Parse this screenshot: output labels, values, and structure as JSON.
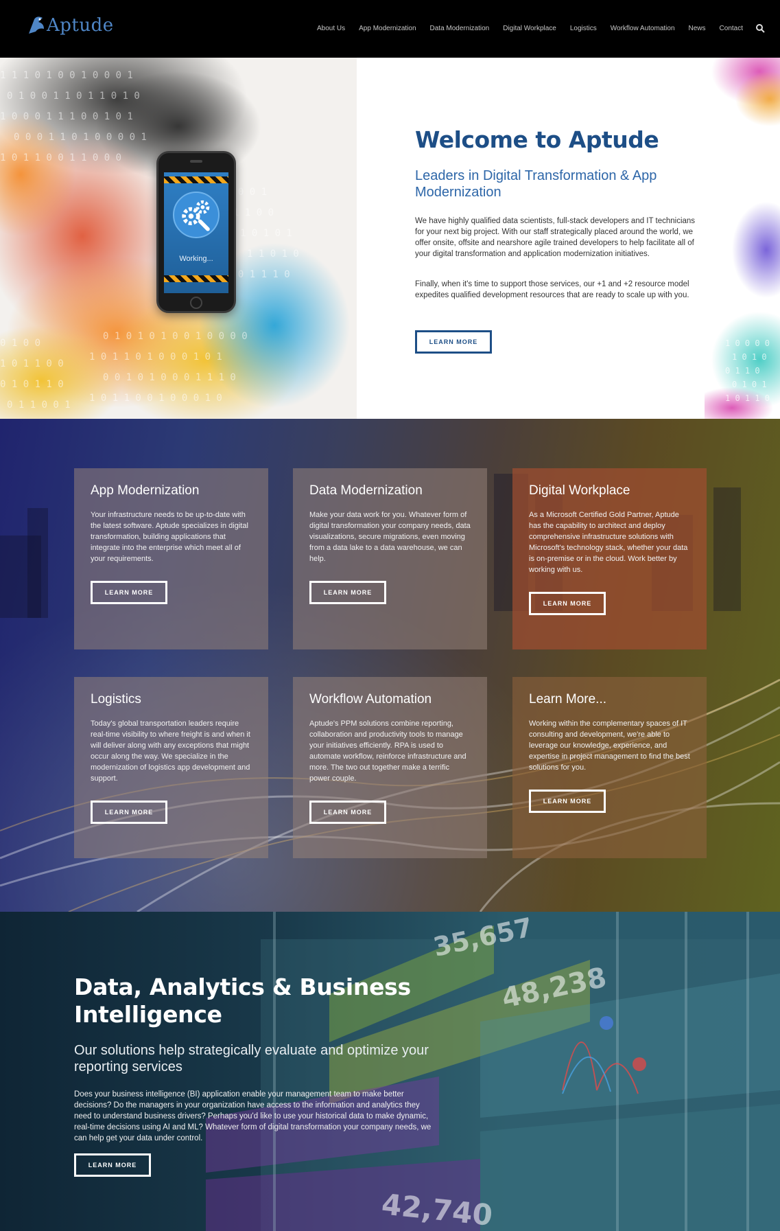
{
  "header": {
    "logo_text": "Aptude",
    "nav": [
      "About Us",
      "App Modernization",
      "Data Modernization",
      "Digital Workplace",
      "Logistics",
      "Workflow Automation",
      "News",
      "Contact"
    ]
  },
  "hero": {
    "title": "Welcome to Aptude",
    "subtitle": "Leaders in Digital Transformation & App Modernization",
    "p1": "We have highly qualified data scientists, full-stack developers and IT technicians for your next big project. With our staff strategically placed around the world, we offer onsite, offsite and nearshore agile trained developers to help facilitate all of your digital transformation and application modernization initiatives.",
    "p2": "Finally, when it's time to support those services, our +1 and +2 resource model expedites qualified development resources that are ready to scale up with you.",
    "button": "LEARN MORE",
    "phone_text": "Working..."
  },
  "services": [
    {
      "title": "App Modernization",
      "body": "Your infrastructure needs to be up-to-date with the latest software. Aptude specializes in digital transformation, building applications that integrate into the enterprise which meet all of your requirements.",
      "button": "LEARN MORE"
    },
    {
      "title": "Data Modernization",
      "body": "Make your data work for you. Whatever form of digital transformation your company needs, data visualizations, secure migrations, even moving from a data lake to a data warehouse, we can help.",
      "button": "LEARN MORE"
    },
    {
      "title": "Digital Workplace",
      "body": "As a Microsoft Certified Gold Partner, Aptude has the capability to architect and deploy comprehensive infrastructure solutions with Microsoft's technology stack, whether your data is on-premise or in the cloud. Work better by working with us.",
      "button": "LEARN MORE"
    },
    {
      "title": "Logistics",
      "body": "Today's global transportation leaders require real-time visibility to where freight is and when it will deliver along with any exceptions that might occur along the way. We specialize in the modernization of logistics app development and support.",
      "button": "LEARN MORE"
    },
    {
      "title": "Workflow Automation",
      "body": "Aptude's PPM solutions combine reporting, collaboration and productivity tools to manage your initiatives efficiently. RPA is used to automate workflow, reinforce infrastructure and more. The two out together make a terrific power couple.",
      "button": "LEARN MORE"
    },
    {
      "title": "Learn More...",
      "body": "Working within the complementary spaces of IT consulting and development, we're able to leverage our knowledge, experience, and expertise in project management to find the best solutions for you.",
      "button": "LEARN MORE"
    }
  ],
  "bi": {
    "title": "Data, Analytics & Business Intelligence",
    "subtitle": "Our solutions help strategically evaluate and optimize your reporting services",
    "body": "Does your business intelligence (BI) application enable your management team to make better decisions? Do the managers in your organization have access to the information and analytics they need to understand business drivers? Perhaps you'd like to use your historical data to make dynamic, real-time decisions using AI and ML? Whatever form of digital transformation your company needs, we can help get your data under control.",
    "button": "LEARN MORE",
    "numbers": [
      "35,657",
      "48,238",
      "42,740"
    ]
  },
  "colors": {
    "brand_blue": "#1d4e86",
    "header_bg": "#000000",
    "link_blue": "#2d66a8"
  }
}
